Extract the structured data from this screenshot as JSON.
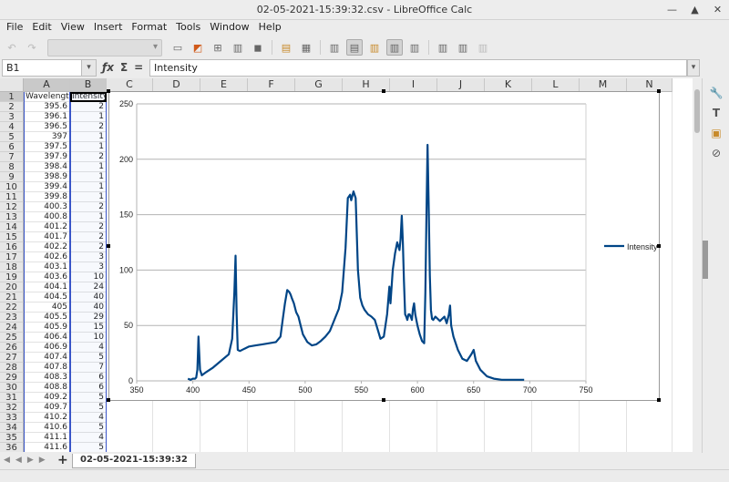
{
  "window": {
    "title": "02-05-2021-15:39:32.csv - LibreOffice Calc"
  },
  "menu": [
    "File",
    "Edit",
    "View",
    "Insert",
    "Format",
    "Tools",
    "Window",
    "Help"
  ],
  "formula_bar": {
    "name_box": "B1",
    "content": "Intensity"
  },
  "columns": [
    "A",
    "B",
    "C",
    "D",
    "E",
    "F",
    "G",
    "H",
    "I",
    "J",
    "K",
    "L",
    "M",
    "N"
  ],
  "rows": [
    [
      "Wavelength",
      "Intensity"
    ],
    [
      "395.6",
      "2"
    ],
    [
      "396.1",
      "1"
    ],
    [
      "396.5",
      "2"
    ],
    [
      "397",
      "1"
    ],
    [
      "397.5",
      "1"
    ],
    [
      "397.9",
      "2"
    ],
    [
      "398.4",
      "1"
    ],
    [
      "398.9",
      "1"
    ],
    [
      "399.4",
      "1"
    ],
    [
      "399.8",
      "1"
    ],
    [
      "400.3",
      "2"
    ],
    [
      "400.8",
      "1"
    ],
    [
      "401.2",
      "2"
    ],
    [
      "401.7",
      "2"
    ],
    [
      "402.2",
      "2"
    ],
    [
      "402.6",
      "3"
    ],
    [
      "403.1",
      "3"
    ],
    [
      "403.6",
      "10"
    ],
    [
      "404.1",
      "24"
    ],
    [
      "404.5",
      "40"
    ],
    [
      "405",
      "40"
    ],
    [
      "405.5",
      "29"
    ],
    [
      "405.9",
      "15"
    ],
    [
      "406.4",
      "10"
    ],
    [
      "406.9",
      "4"
    ],
    [
      "407.4",
      "5"
    ],
    [
      "407.8",
      "7"
    ],
    [
      "408.3",
      "6"
    ],
    [
      "408.8",
      "6"
    ],
    [
      "409.2",
      "5"
    ],
    [
      "409.7",
      "5"
    ],
    [
      "410.2",
      "4"
    ],
    [
      "410.6",
      "5"
    ],
    [
      "411.1",
      "4"
    ],
    [
      "411.6",
      "5"
    ]
  ],
  "sheet": {
    "tab_name": "02-05-2021-15:39:32"
  },
  "chart_data": {
    "type": "line",
    "title": "",
    "xlabel": "",
    "ylabel": "",
    "xlim": [
      350,
      750
    ],
    "ylim": [
      0,
      250
    ],
    "xticks": [
      350,
      400,
      450,
      500,
      550,
      600,
      650,
      700,
      750
    ],
    "yticks": [
      0,
      50,
      100,
      150,
      200,
      250
    ],
    "grid": "horizontal",
    "legend": "right",
    "color": "#004586",
    "series": [
      {
        "name": "Intensity",
        "x": [
          395.6,
          398,
          400,
          402,
          403,
          404,
          404.5,
          405,
          405.5,
          406.4,
          408,
          412,
          418,
          425,
          432,
          435,
          437,
          438,
          439,
          440,
          442,
          446,
          450,
          456,
          462,
          468,
          474,
          478,
          480,
          482,
          484,
          486,
          487,
          488,
          490,
          492,
          494,
          496,
          498,
          502,
          506,
          510,
          514,
          518,
          522,
          526,
          530,
          533,
          536,
          538,
          540,
          541,
          543,
          545,
          547,
          549,
          551,
          553,
          556,
          559,
          562,
          565,
          567,
          570,
          573,
          575,
          576,
          578,
          580,
          582,
          584,
          585,
          586,
          587,
          588,
          589,
          590,
          591,
          592,
          593,
          594,
          595,
          596,
          597,
          598,
          600,
          602,
          604,
          606,
          607,
          608,
          609,
          610,
          611,
          612,
          613,
          614,
          616,
          620,
          624,
          626,
          628,
          629,
          630,
          632,
          636,
          640,
          644,
          648,
          650,
          652,
          656,
          662,
          668,
          675,
          685,
          695
        ],
        "values": [
          2,
          1,
          2,
          2,
          3,
          10,
          24,
          40,
          29,
          10,
          5,
          8,
          12,
          18,
          24,
          38,
          80,
          113,
          60,
          28,
          27,
          29,
          31,
          32,
          33,
          34,
          35,
          40,
          55,
          70,
          82,
          80,
          78,
          75,
          70,
          62,
          58,
          50,
          42,
          35,
          32,
          33,
          36,
          40,
          45,
          55,
          65,
          80,
          120,
          165,
          168,
          163,
          171,
          165,
          100,
          75,
          68,
          64,
          60,
          58,
          55,
          45,
          38,
          40,
          60,
          85,
          70,
          100,
          115,
          125,
          118,
          128,
          149,
          125,
          90,
          60,
          58,
          55,
          60,
          60,
          58,
          55,
          65,
          70,
          60,
          50,
          42,
          36,
          34,
          80,
          150,
          213,
          160,
          95,
          64,
          56,
          55,
          58,
          54,
          58,
          52,
          60,
          68,
          50,
          40,
          28,
          20,
          18,
          24,
          28,
          18,
          10,
          4,
          2,
          1,
          1,
          1
        ]
      }
    ]
  }
}
